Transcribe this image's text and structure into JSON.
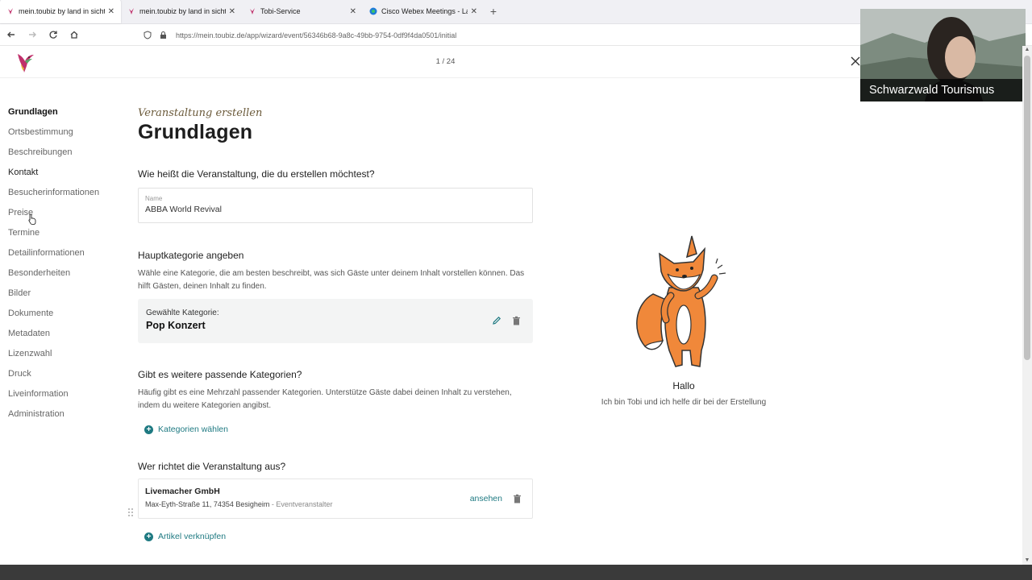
{
  "browser": {
    "tabs": [
      {
        "title": "mein.toubiz by land in sicht",
        "active": true,
        "favicon": "toubiz-bird-icon"
      },
      {
        "title": "mein.toubiz by land in sicht",
        "active": false,
        "favicon": "toubiz-bird-icon"
      },
      {
        "title": "Tobi-Service",
        "active": false,
        "favicon": "toubiz-bird-icon"
      },
      {
        "title": "Cisco Webex Meetings - Landing",
        "active": false,
        "favicon": "webex-icon"
      }
    ],
    "url": "https://mein.toubiz.de/app/wizard/event/56346b68-9a8c-49bb-9754-0df9f4da0501/initial"
  },
  "header": {
    "step": "1 / 24"
  },
  "sidebar": {
    "items": [
      {
        "label": "Grundlagen",
        "state": "active"
      },
      {
        "label": "Ortsbestimmung",
        "state": "normal"
      },
      {
        "label": "Beschreibungen",
        "state": "normal"
      },
      {
        "label": "Kontakt",
        "state": "dark"
      },
      {
        "label": "Besucherinformationen",
        "state": "normal"
      },
      {
        "label": "Preise",
        "state": "normal"
      },
      {
        "label": "Termine",
        "state": "normal"
      },
      {
        "label": "Detailinformationen",
        "state": "normal"
      },
      {
        "label": "Besonderheiten",
        "state": "normal"
      },
      {
        "label": "Bilder",
        "state": "normal"
      },
      {
        "label": "Dokumente",
        "state": "normal"
      },
      {
        "label": "Metadaten",
        "state": "normal"
      },
      {
        "label": "Lizenzwahl",
        "state": "normal"
      },
      {
        "label": "Druck",
        "state": "normal"
      },
      {
        "label": "Liveinformation",
        "state": "normal"
      },
      {
        "label": "Administration",
        "state": "normal"
      }
    ]
  },
  "main": {
    "eyebrow": "Veranstaltung erstellen",
    "title": "Grundlagen",
    "name_question": "Wie heißt die Veranstaltung, die du erstellen möchtest?",
    "name_field": {
      "label": "Name",
      "value": "ABBA World Revival"
    },
    "main_category": {
      "question": "Hauptkategorie angeben",
      "description": "Wähle eine Kategorie, die am besten beschreibt, was sich Gäste unter deinem Inhalt vorstellen können. Das hilft Gästen, deinen Inhalt zu finden.",
      "selected_label": "Gewählte Kategorie:",
      "selected_value": "Pop Konzert"
    },
    "more_categories": {
      "question": "Gibt es weitere passende Kategorien?",
      "description": "Häufig gibt es eine Mehrzahl passender Kategorien. Unterstütze Gäste dabei deinen Inhalt zu verstehen, indem du weitere Kategorien angibst.",
      "action": "Kategorien wählen"
    },
    "organizer": {
      "question": "Wer richtet die Veranstaltung aus?",
      "name": "Livemacher GmbH",
      "address": "Max-Eyth-Straße 11, 74354 Besigheim",
      "role": "- Eventveranstalter",
      "view_label": "ansehen",
      "link_action": "Artikel verknüpfen"
    }
  },
  "helper": {
    "greeting": "Hallo",
    "text": "Ich bin Tobi und ich helfe dir bei der Erstellung"
  },
  "webcam": {
    "name": "Schwarzwald Tourismus"
  },
  "colors": {
    "accent": "#1f7a82",
    "fox_orange": "#f0883a"
  }
}
